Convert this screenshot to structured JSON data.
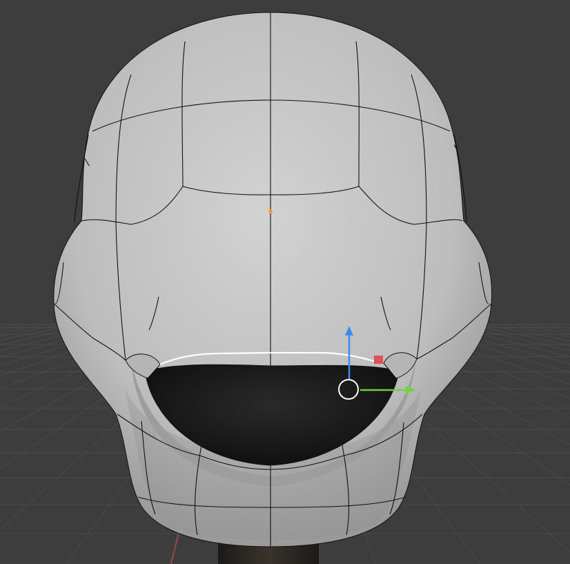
{
  "viewport": {
    "background_color": "#3d3d3d",
    "grid_color": "#4a4a4a",
    "x_axis_color": "#b0484f"
  },
  "mesh": {
    "name_icon": "helmet-head-mesh",
    "surface_color": "#c6c6c6",
    "shadow_color": "#8e8e8e",
    "wire_color": "#111111",
    "mouth_interior_color": "#101010",
    "neck_color": "#2a2520"
  },
  "selection": {
    "selected_edge_color": "#ffffff",
    "origin_color": "#ff9a1f"
  },
  "gizmo": {
    "icon": "translate-gizmo-icon",
    "y_axis_color": "#70d33a",
    "z_axis_color": "#3b8cf0",
    "plane_handle_color": "#e0505a",
    "pivot_color": "#ffffff"
  }
}
